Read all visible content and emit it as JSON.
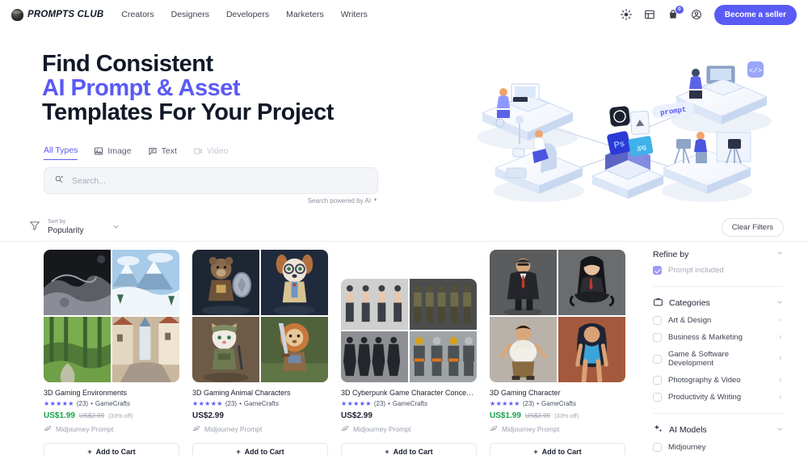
{
  "header": {
    "brand": "PROMPTS CLUB",
    "brand_icon": "sphere-logo-icon",
    "nav": [
      {
        "label": "Creators"
      },
      {
        "label": "Designers"
      },
      {
        "label": "Developers"
      },
      {
        "label": "Marketers"
      },
      {
        "label": "Writers"
      }
    ],
    "icons": [
      {
        "name": "theme-sun-icon"
      },
      {
        "name": "dashboard-grid-icon"
      },
      {
        "name": "cart-icon"
      },
      {
        "name": "account-avatar-icon"
      }
    ],
    "cart_count": "0",
    "seller_button": "Become a seller"
  },
  "hero": {
    "line1": "Find Consistent",
    "line2": "AI Prompt & Asset",
    "line3": "Templates For Your Project",
    "accent_color": "#5a5af5",
    "illustration_label": "prompt"
  },
  "tabs": [
    {
      "label": "All Types",
      "icon": "none",
      "state": "active"
    },
    {
      "label": "Image",
      "icon": "image-icon",
      "state": "enabled"
    },
    {
      "label": "Text",
      "icon": "text-bubble-icon",
      "state": "enabled"
    },
    {
      "label": "Video",
      "icon": "video-icon",
      "state": "disabled"
    }
  ],
  "search": {
    "placeholder": "Search...",
    "value": "",
    "icon": "ai-search-icon",
    "powered_by": "Search powered by AI"
  },
  "filterbar": {
    "sort_icon": "filter-funnel-icon",
    "sort_label": "Sort by",
    "sort_value": "Popularity",
    "clear_label": "Clear Filters"
  },
  "products": [
    {
      "title": "3D Gaming Environments",
      "stars": "★★★★★",
      "reviews": "(23)",
      "seller": "GameCrafts",
      "price": "US$1.99",
      "price_old": "US$2.99",
      "discount": "(33% off)",
      "on_sale": true,
      "model": "Midjourney Prompt",
      "model_icon": "midjourney-icon",
      "cta": "Add to Cart",
      "media_variant": "tall",
      "thumbs": [
        "moon-surface",
        "snow-mountains",
        "green-forest",
        "medieval-village"
      ]
    },
    {
      "title": "3D Gaming Animal Characters",
      "stars": "★★★★★",
      "reviews": "(23)",
      "seller": "GameCrafts",
      "price": "US$2.99",
      "price_old": "",
      "discount": "",
      "on_sale": false,
      "model": "Midjourney Prompt",
      "model_icon": "midjourney-icon",
      "cta": "Add to Cart",
      "media_variant": "tall",
      "thumbs": [
        "bear-knight",
        "dog-scholar",
        "cat-soldier",
        "lion-warrior"
      ]
    },
    {
      "title": "3D Cyberpunk Game Character Concept ...",
      "stars": "★★★★★",
      "reviews": "(23)",
      "seller": "GameCrafts",
      "price": "US$2.99",
      "price_old": "",
      "discount": "",
      "on_sale": false,
      "model": "Midjourney Prompt",
      "model_icon": "midjourney-icon",
      "cta": "Add to Cart",
      "media_variant": "short",
      "thumbs": [
        "turnaround-female",
        "turnaround-soldier",
        "turnaround-dark",
        "turnaround-armored"
      ]
    },
    {
      "title": "3D Gaming Character",
      "stars": "★★★★★",
      "reviews": "(23)",
      "seller": "GameCrafts",
      "price": "US$1.99",
      "price_old": "US$2.99",
      "discount": "(33% off)",
      "on_sale": true,
      "model": "Midjourney Prompt",
      "model_icon": "midjourney-icon",
      "cta": "Add to Cart",
      "media_variant": "tall",
      "thumbs": [
        "suit-bodyguard",
        "sitting-woman",
        "round-man",
        "swimsuit-woman"
      ]
    }
  ],
  "refine": {
    "title": "Refine by",
    "prompt_included": {
      "label": "Prompt included",
      "checked": true
    },
    "categories": {
      "title": "Categories",
      "icon": "briefcase-icon",
      "items": [
        {
          "label": "Art & Design",
          "checked": false
        },
        {
          "label": "Business & Marketing",
          "checked": false
        },
        {
          "label": "Game & Software Development",
          "checked": false
        },
        {
          "label": "Photography & Video",
          "checked": false
        },
        {
          "label": "Productivity & Writing",
          "checked": false
        }
      ]
    },
    "ai_models": {
      "title": "AI Models",
      "icon": "sparkle-icon",
      "items": [
        {
          "label": "Midjourney",
          "checked": false
        }
      ]
    }
  }
}
